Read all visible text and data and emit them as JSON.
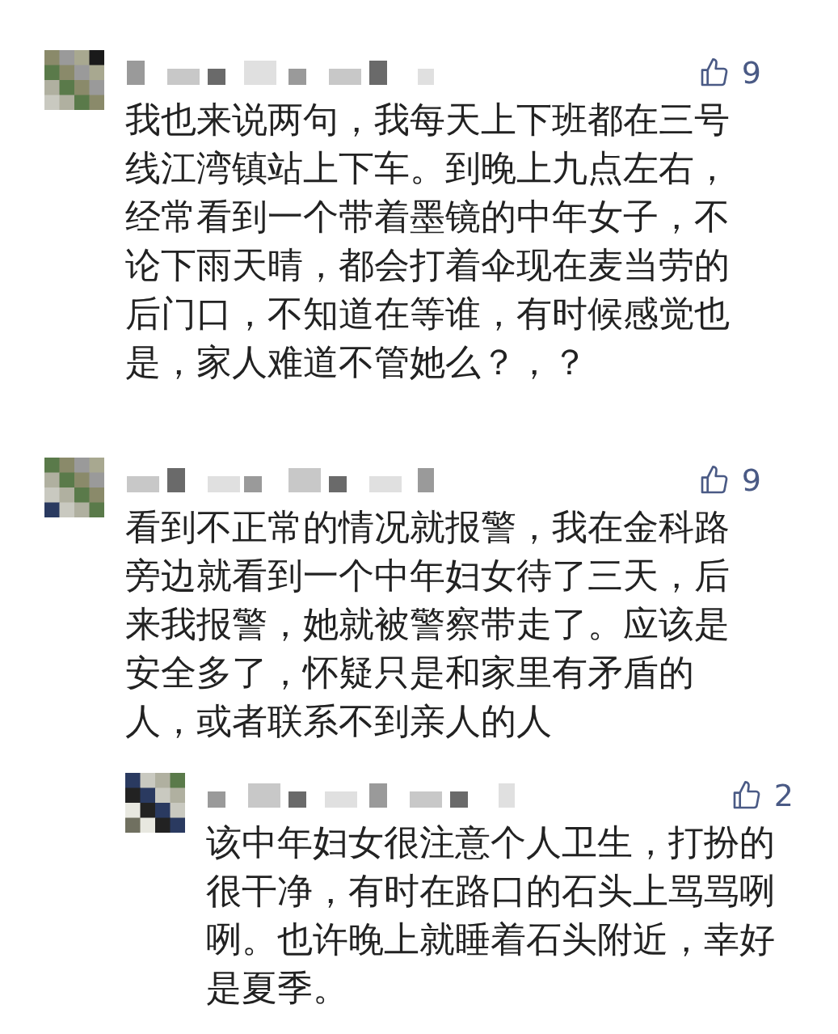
{
  "comments": [
    {
      "likes": "9",
      "text": "我也来说两句，我每天上下班都在三号线江湾镇站上下车。到晚上九点左右，经常看到一个带着墨镜的中年女子，不论下雨天晴，都会打着伞现在麦当劳的后门口，不知道在等谁，有时候感觉也是，家人难道不管她么？，？"
    },
    {
      "likes": "9",
      "text": "看到不正常的情况就报警，我在金科路旁边就看到一个中年妇女待了三天，后来我报警，她就被警察带走了。应该是安全多了，怀疑只是和家里有矛盾的人，或者联系不到亲人的人",
      "replies": [
        {
          "likes": "2",
          "text": "该中年妇女很注意个人卫生，打扮的很干净，有时在路口的石头上骂骂咧咧。也许晚上就睡着石头附近，幸好是夏季。"
        }
      ]
    }
  ]
}
